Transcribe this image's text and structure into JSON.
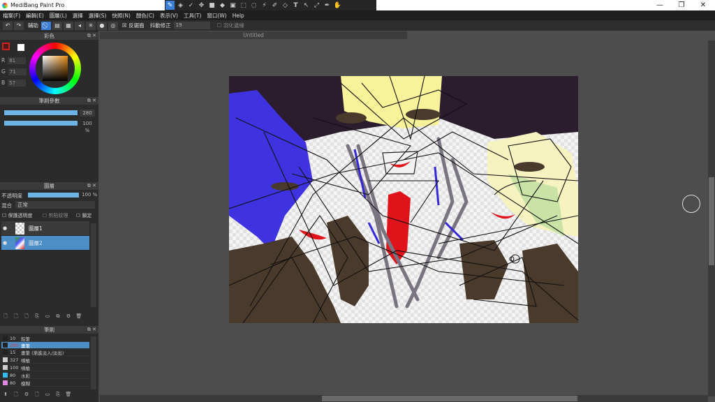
{
  "app": {
    "title": "MediBang Paint Pro",
    "win_min": "—",
    "win_max": "❐",
    "win_close": "✕"
  },
  "tools": [
    "brush-icon",
    "eraser-icon",
    "select-icon",
    "move-icon",
    "fill-rect-icon",
    "bucket-icon",
    "gradient-icon",
    "rect-select-icon",
    "lasso-icon",
    "wand-icon",
    "select-pen-icon",
    "select-eraser-icon",
    "text-icon",
    "operation-icon",
    "eyedropper-icon",
    "hand-icon"
  ],
  "menu": [
    "檔案(F)",
    "編輯(E)",
    "圖層(L)",
    "選擇",
    "選擇(S)",
    "快照(N)",
    "顏色(C)",
    "表示(V)",
    "工具(T)",
    "窗口(W)",
    "Help"
  ],
  "toolbar": {
    "assist_label": "輔助",
    "antialias_label": "反鋸齒",
    "stabilizer_label": "抖動修正",
    "stabilizer_value": "19",
    "feather_label": "羽化邊緣"
  },
  "color_panel": {
    "title": "彩色",
    "r_label": "R",
    "r_value": "81",
    "g_label": "G",
    "g_value": "71",
    "b_label": "B",
    "b_value": "57",
    "primary_color": "#511a1a",
    "secondary_color": "#ffffff"
  },
  "brush_params": {
    "title": "筆刷參數",
    "size_value": "280",
    "size_fraction": 1.0,
    "opacity_value": "100 %",
    "opacity_fraction": 1.0
  },
  "layer_panel": {
    "title": "圖層",
    "opacity_label": "不透明度",
    "opacity_value": "100 %",
    "blend_label": "混合",
    "blend_value": "正常",
    "protect_alpha": "保護透明度",
    "clipping": "剪貼紋理",
    "lock": "鎖定",
    "layers": [
      {
        "name": "圖層1",
        "selected": false
      },
      {
        "name": "圖層2",
        "selected": true
      }
    ]
  },
  "brush_panel": {
    "title": "筆刷",
    "brushes": [
      {
        "size": "10",
        "name": "鉛筆",
        "color": "#222222",
        "selected": false
      },
      {
        "size": "280",
        "name": "畫筆",
        "color": "#222222",
        "selected": true
      },
      {
        "size": "15",
        "name": "畫筆 (漸進淡入/淡出)",
        "color": "#222222",
        "selected": false
      },
      {
        "size": "327",
        "name": "噴槍",
        "color": "#cccccc",
        "selected": false
      },
      {
        "size": "100",
        "name": "噴槍",
        "color": "#cccccc",
        "selected": false
      },
      {
        "size": "80",
        "name": "水彩",
        "color": "#33bbee",
        "selected": false
      },
      {
        "size": "80",
        "name": "模糊",
        "color": "#dd88dd",
        "selected": false
      }
    ]
  },
  "document": {
    "tab_title": "Untitled"
  }
}
